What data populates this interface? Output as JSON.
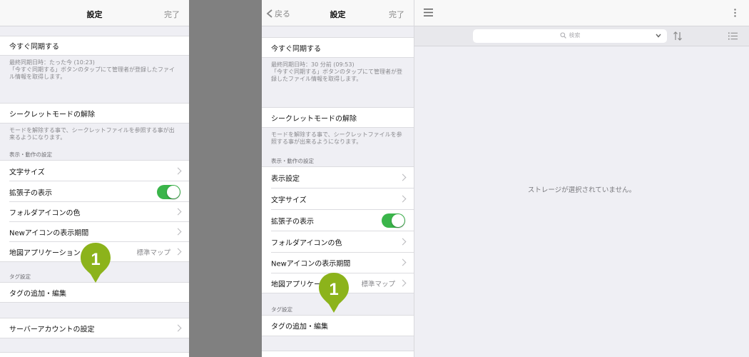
{
  "panel_a": {
    "title": "設定",
    "done": "完了",
    "sync_now": "今すぐ同期する",
    "sync_note": "最終同期日時：たった今 (10:23)\n「今すぐ同期する」ボタンのタップにて管理者が登録したファイル情報を取得します。",
    "secret_off": "シークレットモードの解除",
    "secret_note": "モードを解除する事で、シークレットファイルを参照する事が出来るようになります。",
    "display_header": "表示・動作の設定",
    "items": [
      {
        "label": "文字サイズ"
      },
      {
        "label": "拡張子の表示"
      },
      {
        "label": "フォルダアイコンの色"
      },
      {
        "label": "Newアイコンの表示期間"
      },
      {
        "label": "地図アプリケーション",
        "value": "標準マップ"
      }
    ],
    "tag_header": "タグ設定",
    "tag_item": "タグの追加・編集",
    "server_item": "サーバーアカウントの設定",
    "marker": "1"
  },
  "panel_b": {
    "back": "戻る",
    "title": "設定",
    "done": "完了",
    "sync_now": "今すぐ同期する",
    "sync_note": "最終同期日時：30 分前 (09:53)\n「今すぐ同期する」ボタンのタップにて管理者が登録したファイル情報を取得します。",
    "secret_off": "シークレットモードの解除",
    "secret_note": "モードを解除する事で、シークレットファイルを参照する事が出来るようになります。",
    "display_header": "表示・動作の設定",
    "items": [
      {
        "label": "表示設定"
      },
      {
        "label": "文字サイズ"
      },
      {
        "label": "拡張子の表示"
      },
      {
        "label": "フォルダアイコンの色"
      },
      {
        "label": "Newアイコンの表示期間"
      },
      {
        "label": "地図アプリケー",
        "value": "標準マップ"
      }
    ],
    "tag_header": "タグ設定",
    "tag_item": "タグの追加・編集",
    "marker": "1"
  },
  "main": {
    "search_placeholder": "検索",
    "empty_message": "ストレージが選択されていません。",
    "icons": [
      "hamburger-menu-icon",
      "more-vertical-icon",
      "search-icon",
      "chevron-down-icon",
      "sort-icon",
      "list-view-icon"
    ]
  },
  "colors": {
    "toggle_on": "#3ab54a",
    "marker": "#8cb31b",
    "background": "#efeff4"
  }
}
